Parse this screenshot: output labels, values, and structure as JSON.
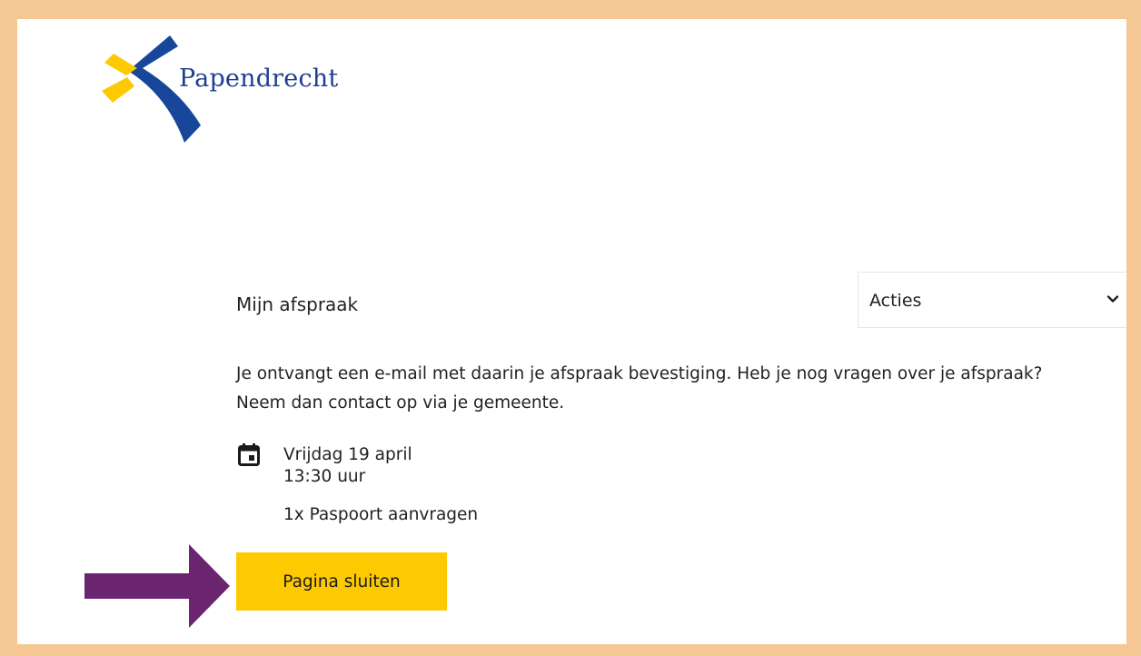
{
  "logo": {
    "name": "Papendrecht",
    "colors": {
      "blue": "#17469b",
      "yellow": "#fdc900"
    }
  },
  "appointment": {
    "heading": "Mijn afspraak",
    "info_line_1": "Je ontvangt een e-mail met daarin je afspraak bevestiging. Heb je nog vragen over je afspraak?",
    "info_line_2": "Neem dan contact op via je gemeente.",
    "date": "Vrijdag 19 april",
    "time": "13:30 uur",
    "service": "1x Paspoort aanvragen"
  },
  "actions": {
    "selected": "Acties",
    "icon": "chevron-down-icon"
  },
  "close_button": {
    "label": "Pagina sluiten",
    "color": "#fdc900"
  },
  "annotation": {
    "icon": "arrow-right-icon",
    "color": "#6b2570"
  },
  "page": {
    "border_color": "#f5c893"
  }
}
